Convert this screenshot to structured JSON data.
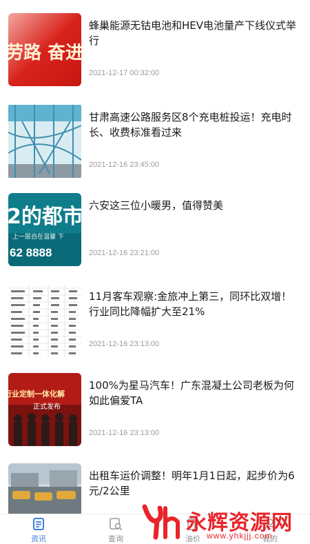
{
  "news": [
    {
      "title": "蜂巢能源无钴电池和HEV电池量产下线仪式举行",
      "time": "2021-12-17 00:32:00",
      "thumb_text": "劳路 奋进"
    },
    {
      "title": "甘肃高速公路服务区8个充电桩投运！充电时长、收费标准看过来",
      "time": "2021-12-16 23:45:00"
    },
    {
      "title": "六安这三位小暖男，值得赞美",
      "time": "2021-12-16 23:21:00",
      "thumb_text": "2的都市",
      "thumb_sub": "上一层自在温馨  下",
      "thumb_phone": "62 8888"
    },
    {
      "title": "11月客车观察:金旅冲上第三，同环比双增！行业同比降幅扩大至21%",
      "time": "2021-12-16 23:13:00"
    },
    {
      "title": "100%为星马汽车！广东混凝土公司老板为何如此偏爱TA",
      "time": "2021-12-16 23:13:00",
      "thumb_text": "行业定制一体化解",
      "thumb_sub": "正式发布"
    },
    {
      "title": "出租车运价调整！明年1月1日起，起步价为6元/2公里",
      "time": ""
    }
  ],
  "tabs": [
    {
      "label": "资讯",
      "icon": "news-icon",
      "active": true
    },
    {
      "label": "查询",
      "icon": "search-icon",
      "active": false
    },
    {
      "label": "油价",
      "icon": "fuel-icon",
      "active": false
    },
    {
      "label": "我的",
      "icon": "user-icon",
      "active": false
    }
  ],
  "watermark": {
    "name": "永辉资源网",
    "url": "www.yhkjjj.com"
  },
  "colors": {
    "accent": "#3b7ddd",
    "watermark": "#e8242a",
    "text": "#1a1a1a",
    "time": "#9a9a9a"
  }
}
